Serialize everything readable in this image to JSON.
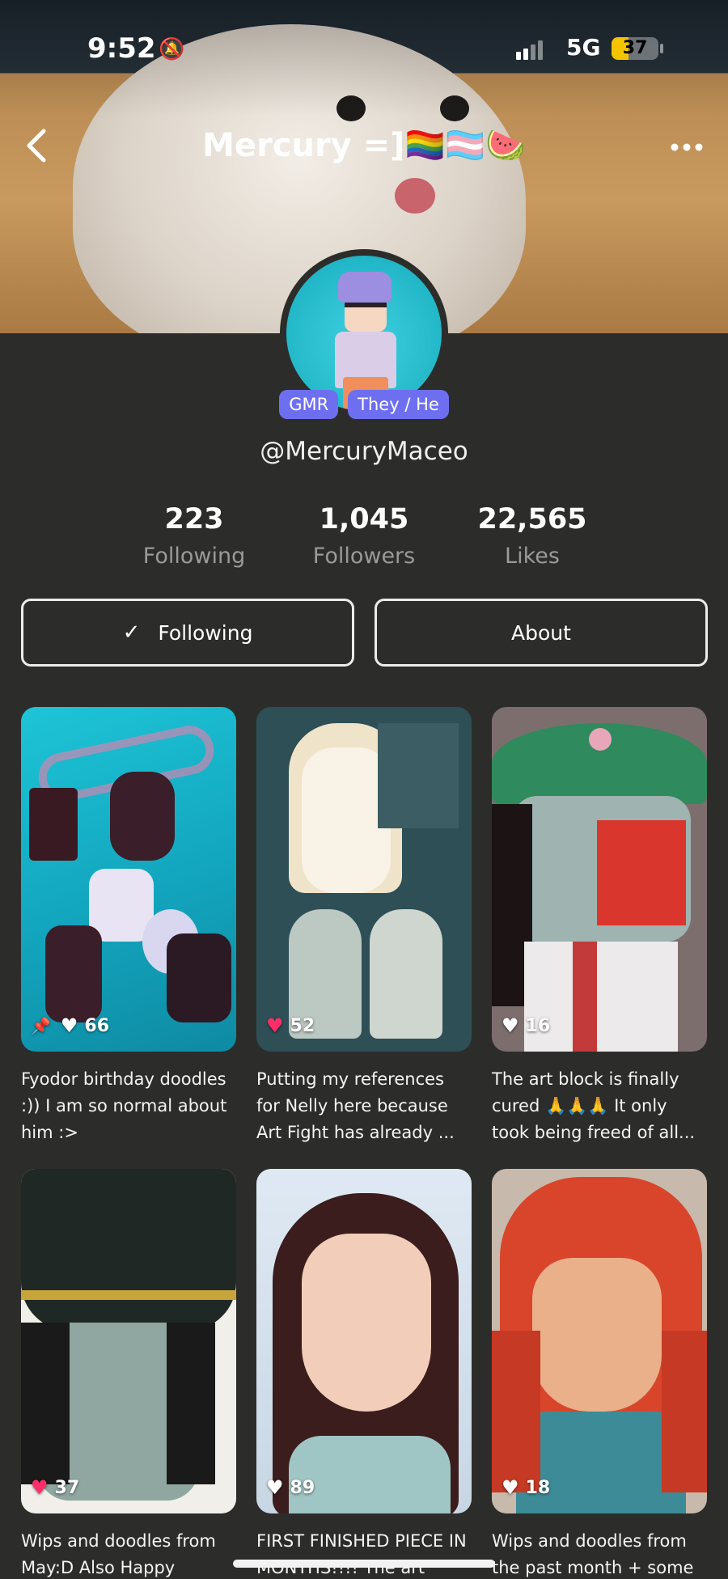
{
  "status_bar": {
    "time": "9:52",
    "network": "5G",
    "battery": "37",
    "battery_level": 0.37
  },
  "header": {
    "title": "Mercury =]🏳️‍🌈🏳️‍⚧️🍉",
    "back_label": "Back",
    "more_label": "More options"
  },
  "profile": {
    "pronoun_tags": [
      "GMR",
      "They / He"
    ],
    "handle": "@MercuryMaceo",
    "stats": [
      {
        "value": "223",
        "label": "Following"
      },
      {
        "value": "1,045",
        "label": "Followers"
      },
      {
        "value": "22,565",
        "label": "Likes"
      }
    ],
    "following_button": "Following",
    "about_button": "About"
  },
  "colors": {
    "background": "#2c2d2a",
    "pill": "#6e6ff0",
    "heart_pink": "#ff2d6a",
    "battery": "#f5c400"
  },
  "posts": [
    {
      "likes": "66",
      "pinned": true,
      "liked": false,
      "caption": "Fyodor birthday doodles :)) I am so normal about him :>"
    },
    {
      "likes": "52",
      "pinned": false,
      "liked": true,
      "caption": "Putting my references for Nelly here because Art Fight has already ..."
    },
    {
      "likes": "16",
      "pinned": false,
      "liked": false,
      "caption": "The art block is finally cured 🙏🙏🙏 It only took being freed of all..."
    },
    {
      "likes": "37",
      "pinned": false,
      "liked": true,
      "caption": "Wips and doodles from May:D Also Happy"
    },
    {
      "likes": "89",
      "pinned": false,
      "liked": false,
      "caption": "FIRST FINISHED PIECE IN MONTHS!!!! The art"
    },
    {
      "likes": "18",
      "pinned": false,
      "liked": false,
      "caption": "Wips and doodles from the past month + some"
    }
  ]
}
